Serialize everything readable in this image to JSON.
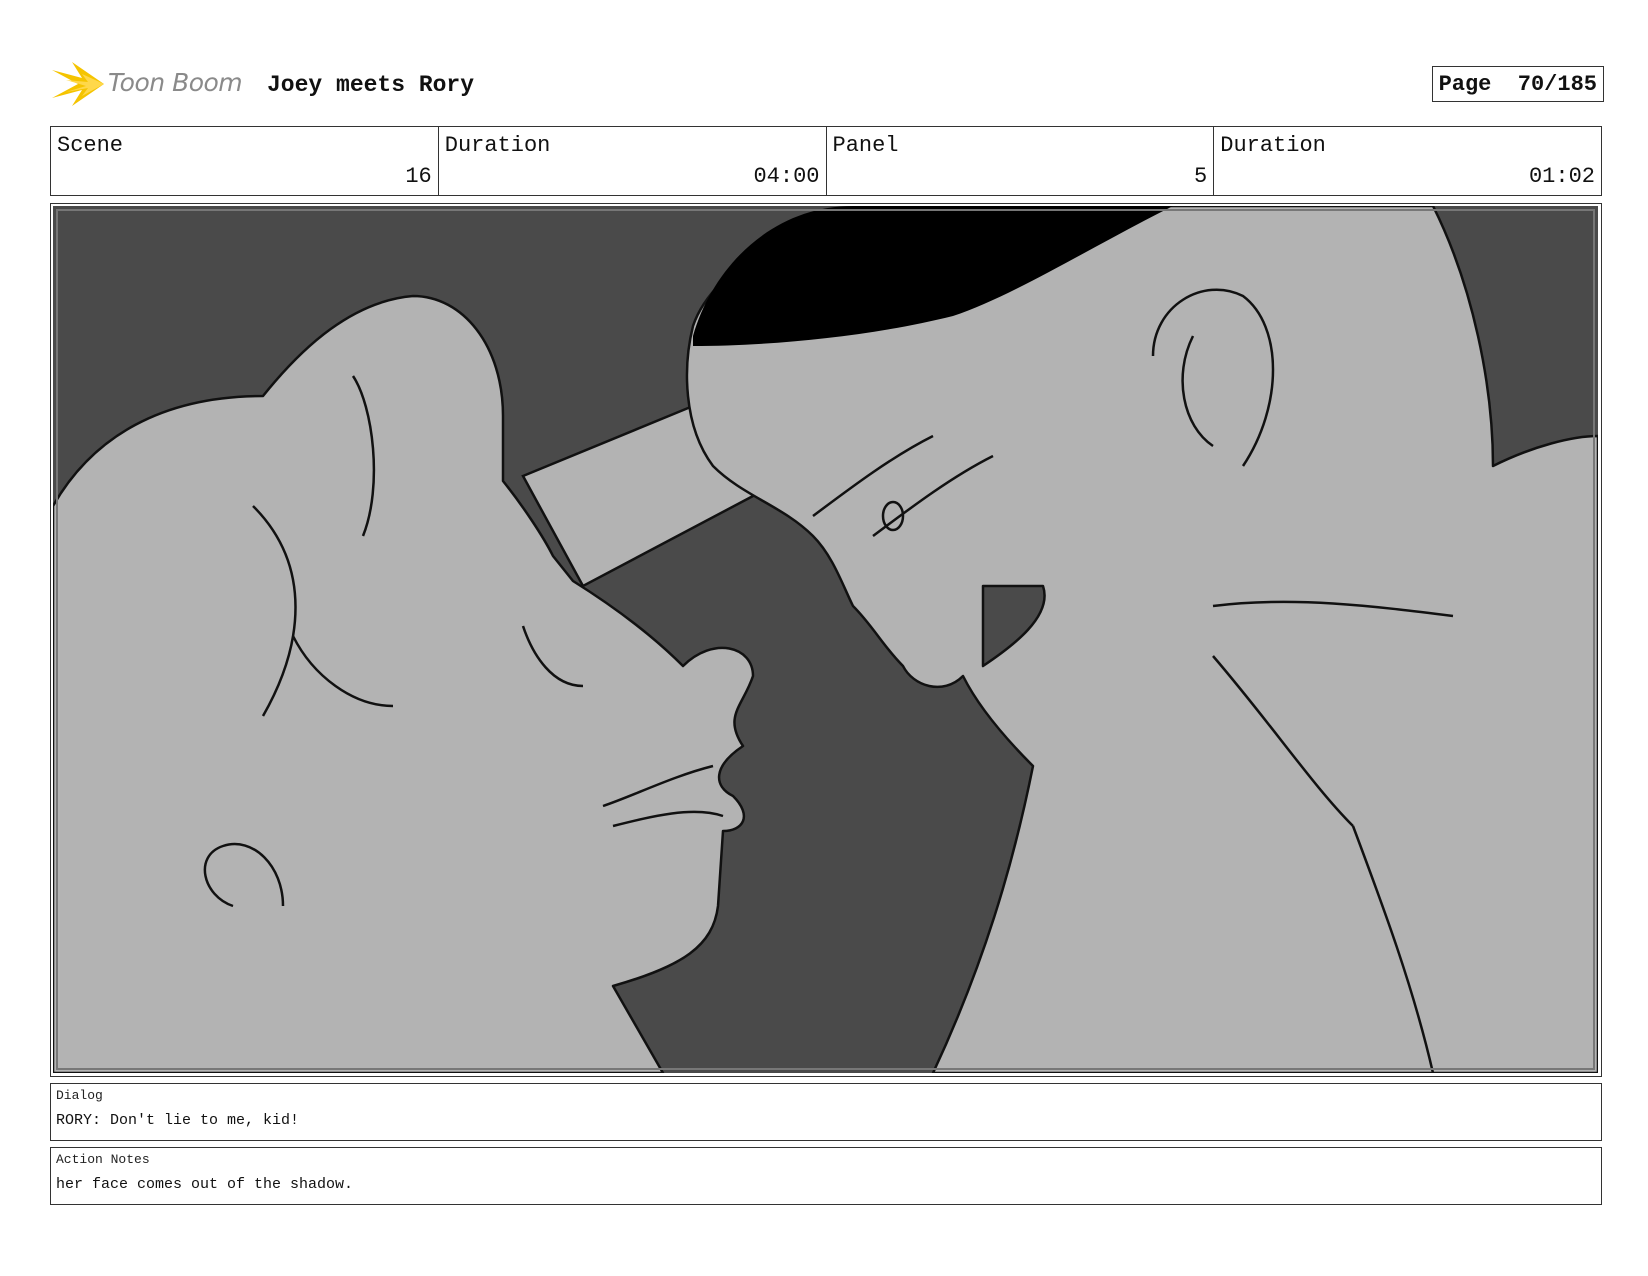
{
  "header": {
    "logo_text": "Toon Boom",
    "project_title": "Joey meets Rory",
    "page_label": "Page",
    "page_value": "70/185"
  },
  "info": {
    "scene_label": "Scene",
    "scene_value": "16",
    "scene_duration_label": "Duration",
    "scene_duration_value": "04:00",
    "panel_label": "Panel",
    "panel_value": "5",
    "panel_duration_label": "Duration",
    "panel_duration_value": "01:02"
  },
  "dialog": {
    "label": "Dialog",
    "text": "RORY: Don't lie to me, kid!"
  },
  "action_notes": {
    "label": "Action Notes",
    "text": "her face comes out of the shadow."
  },
  "colors": {
    "logo_accent": "#f5c400",
    "shadow_bg": "#4a4a4a",
    "skin_tone": "#b3b3b3",
    "hat": "#000000"
  }
}
